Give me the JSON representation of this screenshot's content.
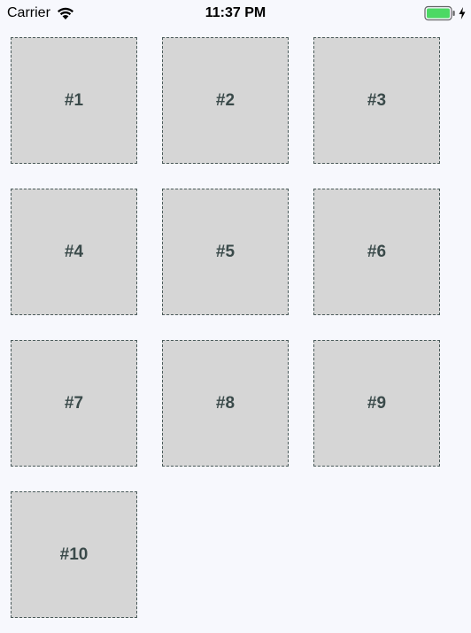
{
  "status_bar": {
    "carrier": "Carrier",
    "time": "11:37 PM",
    "battery_color": "#4cd964"
  },
  "tiles": [
    {
      "label": "#1"
    },
    {
      "label": "#2"
    },
    {
      "label": "#3"
    },
    {
      "label": "#4"
    },
    {
      "label": "#5"
    },
    {
      "label": "#6"
    },
    {
      "label": "#7"
    },
    {
      "label": "#8"
    },
    {
      "label": "#9"
    },
    {
      "label": "#10"
    }
  ]
}
